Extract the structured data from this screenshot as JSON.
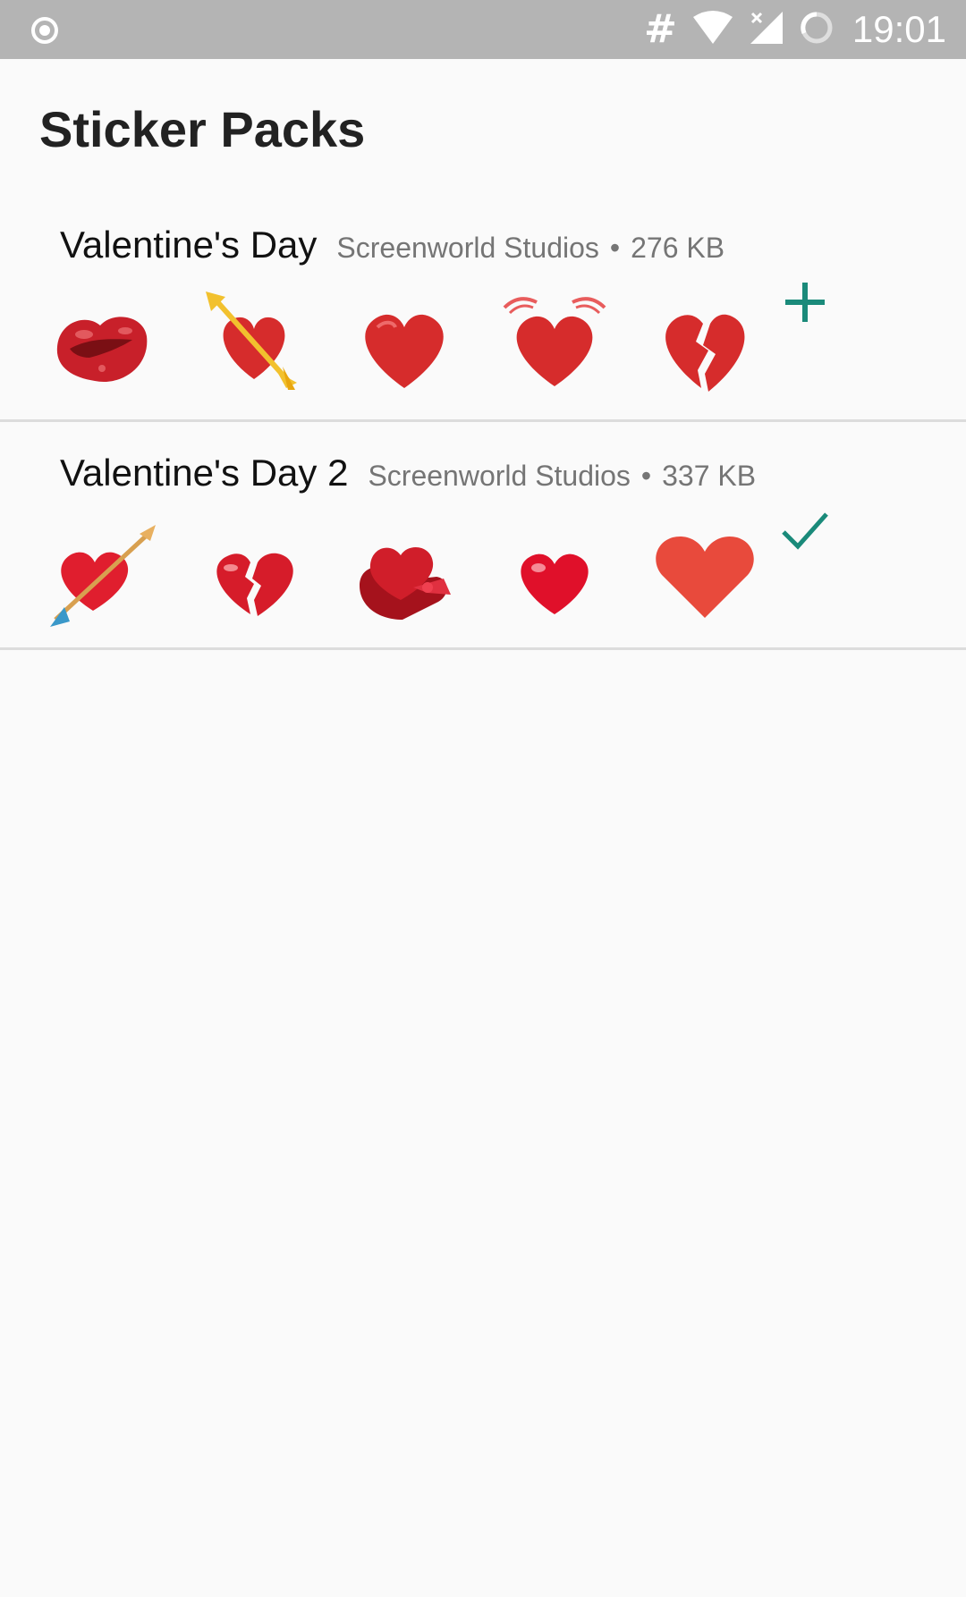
{
  "status_bar": {
    "time": "19:01",
    "hash_glyph": "#",
    "icons": [
      "record-icon",
      "hash-icon",
      "wifi-icon",
      "signal-icon",
      "battery-icon"
    ]
  },
  "header": {
    "title": "Sticker Packs"
  },
  "packs": [
    {
      "name": "Valentine's Day",
      "publisher": "Screenworld Studios",
      "separator": "•",
      "size": "276 KB",
      "action": "add-icon",
      "stickers": [
        "kiss-lips-icon",
        "heart-with-arrow-icon",
        "red-heart-icon",
        "beating-heart-icon",
        "broken-heart-icon"
      ]
    },
    {
      "name": "Valentine's Day 2",
      "publisher": "Screenworld Studios",
      "separator": "•",
      "size": "337 KB",
      "action": "check-icon",
      "stickers": [
        "heart-arrow-icon",
        "broken-heart-icon",
        "heart-gift-box-icon",
        "glossy-heart-icon",
        "flat-heart-icon"
      ]
    }
  ],
  "colors": {
    "accent": "#1a8a7a",
    "heart_red": "#d62c2c",
    "status_bar": "#b4b4b4",
    "background": "#fafafa"
  }
}
